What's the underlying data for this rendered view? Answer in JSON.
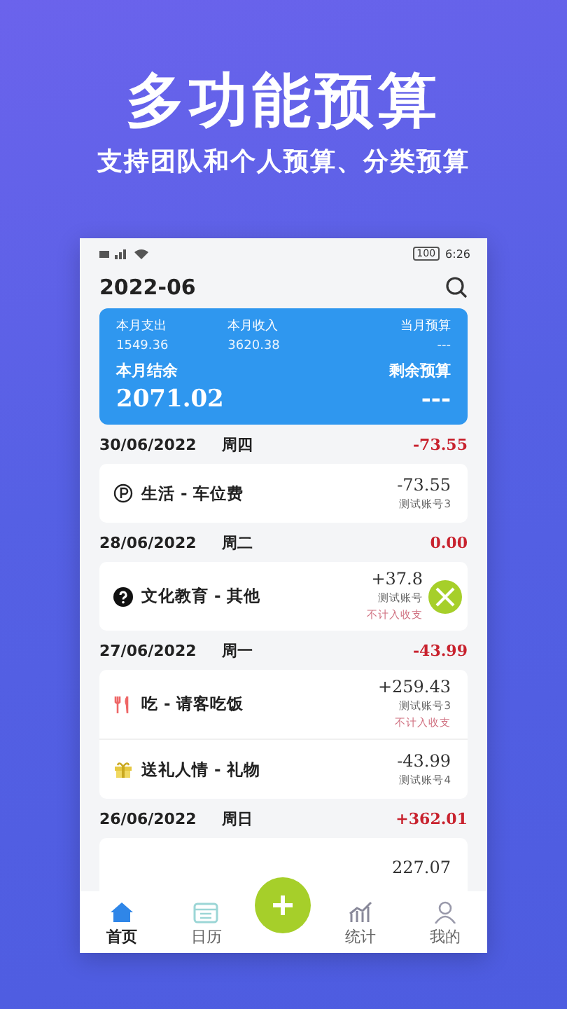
{
  "headline": "多功能预算",
  "subtitle": "支持团队和个人预算、分类预算",
  "status_bar": {
    "battery": "100",
    "time": "6:26"
  },
  "header": {
    "title": "2022-06"
  },
  "summary": {
    "expense_label": "本月支出",
    "expense": "1549.36",
    "income_label": "本月收入",
    "income": "3620.38",
    "budget_label": "当月预算",
    "budget": "---",
    "balance_label": "本月结余",
    "balance": "2071.02",
    "remaining_label": "剩余预算",
    "remaining": "---"
  },
  "days": [
    {
      "date": "30/06/2022",
      "weekday": "周四",
      "total": "-73.55",
      "entries": [
        {
          "title": "生活 - 车位费",
          "amount": "-73.55",
          "account": "测试账号3"
        }
      ]
    },
    {
      "date": "28/06/2022",
      "weekday": "周二",
      "total": "0.00",
      "entries": [
        {
          "title": "文化教育 - 其他",
          "amount": "+37.8",
          "account": "测试账号",
          "note": "不计入收支"
        }
      ]
    },
    {
      "date": "27/06/2022",
      "weekday": "周一",
      "total": "-43.99",
      "entries": [
        {
          "title": "吃 - 请客吃饭",
          "amount": "+259.43",
          "account": "测试账号3",
          "note": "不计入收支"
        },
        {
          "title": "送礼人情 - 礼物",
          "amount": "-43.99",
          "account": "测试账号4"
        }
      ]
    },
    {
      "date": "26/06/2022",
      "weekday": "周日",
      "total": "+362.01",
      "entries": [
        {
          "amount": "227.07"
        }
      ]
    }
  ],
  "nav": [
    {
      "kind": "tab",
      "label": "首页",
      "selected": true
    },
    {
      "kind": "tab",
      "label": "日历",
      "selected": false
    },
    {
      "kind": "add"
    },
    {
      "kind": "tab",
      "label": "统计",
      "selected": false
    },
    {
      "kind": "tab",
      "label": "我的",
      "selected": false
    }
  ]
}
